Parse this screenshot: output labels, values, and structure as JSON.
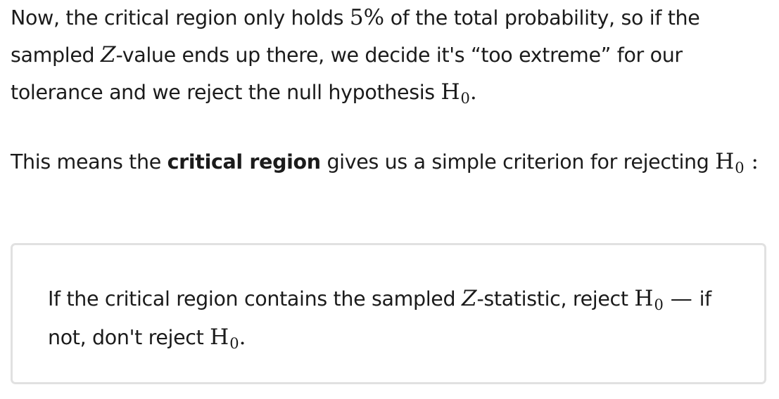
{
  "paragraph_1": {
    "text_a": "Now, the critical region only holds ",
    "math_percent": "5%",
    "text_b": " of the total probability, so if the sampled ",
    "math_z": "Z",
    "text_c": "-value ends up there, we decide it's “too extreme” for our tolerance and we reject the null hypothesis ",
    "math_h": "H",
    "math_h_sub": "0",
    "text_end": "."
  },
  "paragraph_2": {
    "text_a": "This means the ",
    "bold": "critical region",
    "text_b": " gives us a simple criterion for rejecting ",
    "math_h": "H",
    "math_h_sub": "0",
    "text_end": " :"
  },
  "callout": {
    "text_a": "If the critical region contains the sampled ",
    "math_z": "Z",
    "text_b": "-statistic, reject ",
    "math_h": "H",
    "math_h_sub": "0",
    "dash": " — ",
    "text_c": "if not, don't reject ",
    "math_h2": "H",
    "math_h2_sub": "0",
    "text_end": "."
  }
}
